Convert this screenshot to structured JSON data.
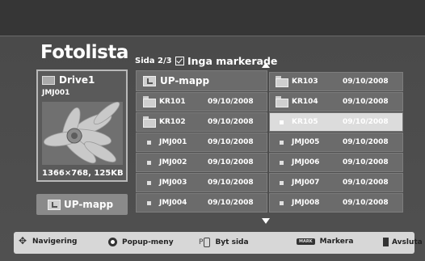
{
  "title": "Fotolista",
  "page_indicator": "Sida 2/3",
  "marked_status": "Inga markerade",
  "drive": {
    "name": "Drive1",
    "file": "JMJ001",
    "resolution": "1366×768, 125KB"
  },
  "up_button_label": "UP-mapp",
  "up_folder_label": "UP-mapp",
  "left_items": [
    {
      "name": "KR101",
      "date": "09/10/2008",
      "type": "folder"
    },
    {
      "name": "KR102",
      "date": "09/10/2008",
      "type": "folder"
    },
    {
      "name": "JMJ001",
      "date": "09/10/2008",
      "type": "file"
    },
    {
      "name": "JMJ002",
      "date": "09/10/2008",
      "type": "file"
    },
    {
      "name": "JMJ003",
      "date": "09/10/2008",
      "type": "file"
    },
    {
      "name": "JMJ004",
      "date": "09/10/2008",
      "type": "file"
    }
  ],
  "right_items": [
    {
      "name": "KR103",
      "date": "09/10/2008",
      "type": "folder"
    },
    {
      "name": "KR104",
      "date": "09/10/2008",
      "type": "folder"
    },
    {
      "name": "KR105",
      "date": "09/10/2008",
      "type": "file",
      "selected": true
    },
    {
      "name": "JMJ005",
      "date": "09/10/2008",
      "type": "file"
    },
    {
      "name": "JMJ006",
      "date": "09/10/2008",
      "type": "file"
    },
    {
      "name": "JMJ007",
      "date": "09/10/2008",
      "type": "file"
    },
    {
      "name": "JMJ008",
      "date": "09/10/2008",
      "type": "file"
    }
  ],
  "footer": {
    "navigate": "Navigering",
    "popup": "Popup-meny",
    "p_key": "P",
    "page": "Byt sida",
    "mark_key": "MARK",
    "mark": "Markera",
    "exit": "Avsluta"
  },
  "icons": {
    "drive": "drive-icon",
    "folder": "folder-icon",
    "file": "file-square-icon",
    "up": "up-folder-icon"
  },
  "colors": {
    "background": "#505050",
    "cell": "#6b6b6b",
    "selected": "#dcdcdc",
    "footer": "#d7d7d7"
  }
}
